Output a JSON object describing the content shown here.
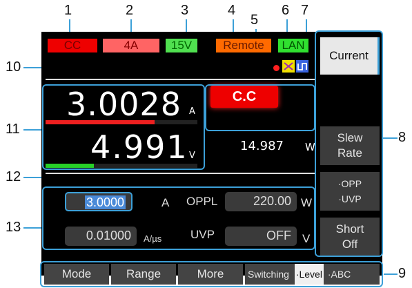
{
  "callouts": [
    "1",
    "2",
    "3",
    "4",
    "5",
    "6",
    "7",
    "8",
    "9",
    "10",
    "11",
    "12",
    "13"
  ],
  "status_bar": {
    "mode": "CC",
    "range": "4A",
    "voltage_range": "15V",
    "remote": "Remote",
    "lan": "LAN"
  },
  "colors": {
    "cc_red": "#ee0000",
    "range_pink": "#ff6060",
    "green": "#40e040",
    "remote_orange": "#ff6a00",
    "callout_blue": "#3ca0d8"
  },
  "measurement": {
    "current_value": "3.0028",
    "current_unit": "A",
    "voltage_value": "4.991",
    "voltage_unit": "V",
    "current_bar_fraction": 0.72,
    "voltage_bar_fraction": 0.32,
    "mode_indicator": "C.C",
    "power_value": "14.987",
    "power_unit": "W"
  },
  "settings": {
    "current_value": "3.0000",
    "current_unit": "A",
    "oppl_label": "OPPL",
    "oppl_value": "220.00",
    "oppl_unit": "W",
    "slew_value": "0.01000",
    "slew_unit": "A/µs",
    "uvp_label": "UVP",
    "uvp_value": "OFF",
    "uvp_unit": "V"
  },
  "softkeys": {
    "current": "Current",
    "slew_line1": "Slew",
    "slew_line2": "Rate",
    "opp": "·OPP",
    "uvp": "·UVP",
    "short_line1": "Short",
    "short_line2": "Off"
  },
  "function_keys": {
    "mode": "Mode",
    "range": "Range",
    "more": "More",
    "switching": "Switching",
    "level": "·Level",
    "abc": "·ABC"
  }
}
